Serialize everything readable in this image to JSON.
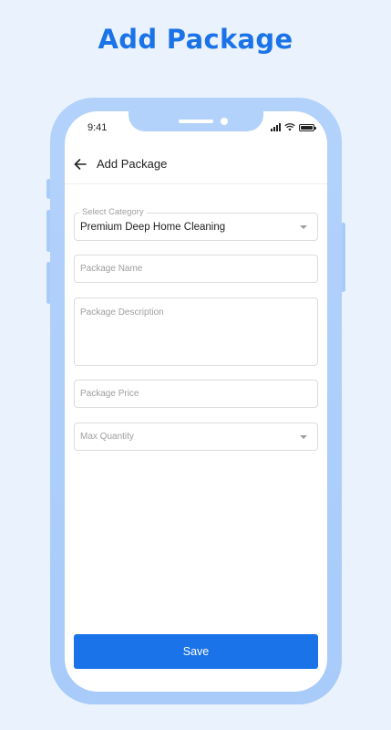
{
  "hero": {
    "title": "Add Package"
  },
  "status_bar": {
    "time": "9:41"
  },
  "app_bar": {
    "title": "Add Package"
  },
  "form": {
    "category": {
      "label": "Select Category",
      "value": "Premium Deep Home Cleaning"
    },
    "package_name": {
      "placeholder": "Package Name"
    },
    "package_description": {
      "placeholder": "Package Description"
    },
    "package_price": {
      "placeholder": "Package Price"
    },
    "max_quantity": {
      "placeholder": "Max Quantity"
    }
  },
  "actions": {
    "save_label": "Save"
  },
  "colors": {
    "accent": "#1A73E8",
    "background": "#EAF2FD",
    "frame": "#B3D2FB"
  },
  "icons": {
    "back": "arrow-left-icon",
    "dropdown": "caret-down-icon",
    "signal": "signal-icon",
    "wifi": "wifi-icon",
    "battery": "battery-icon"
  }
}
